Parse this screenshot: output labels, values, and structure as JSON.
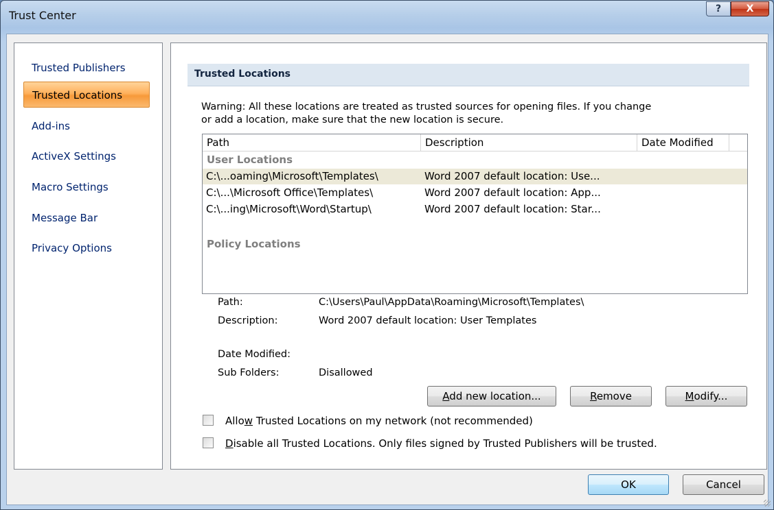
{
  "window": {
    "title": "Trust Center",
    "help_label": "?",
    "close_label": "X"
  },
  "sidebar": {
    "items": [
      {
        "label": "Trusted Publishers"
      },
      {
        "label": "Trusted Locations"
      },
      {
        "label": "Add-ins"
      },
      {
        "label": "ActiveX Settings"
      },
      {
        "label": "Macro Settings"
      },
      {
        "label": "Message Bar"
      },
      {
        "label": "Privacy Options"
      }
    ]
  },
  "main": {
    "section_title": "Trusted Locations",
    "warning_line1": "Warning: All these locations are treated as trusted sources for opening files.  If you change",
    "warning_line2": "or add a location, make sure that the new location is secure.",
    "list": {
      "columns": [
        "Path",
        "Description",
        "Date Modified"
      ],
      "user_group": "User Locations",
      "rows": [
        {
          "path": "C:\\...oaming\\Microsoft\\Templates\\",
          "description": "Word 2007 default location: Use...",
          "date": ""
        },
        {
          "path": "C:\\...\\Microsoft Office\\Templates\\",
          "description": "Word 2007 default location: App...",
          "date": ""
        },
        {
          "path": "C:\\...ing\\Microsoft\\Word\\Startup\\",
          "description": "Word 2007 default location: Star...",
          "date": ""
        }
      ],
      "policy_group": "Policy Locations"
    },
    "details": {
      "path_label": "Path:",
      "path_value": "C:\\Users\\Paul\\AppData\\Roaming\\Microsoft\\Templates\\",
      "description_label": "Description:",
      "description_value": "Word 2007 default location: User Templates",
      "date_label": "Date Modified:",
      "date_value": "",
      "subfolders_label": "Sub Folders:",
      "subfolders_value": "Disallowed"
    },
    "buttons": {
      "add_pre": "",
      "add_u": "A",
      "add_post": "dd new location...",
      "remove_pre": "",
      "remove_u": "R",
      "remove_post": "emove",
      "modify_pre": "",
      "modify_u": "M",
      "modify_post": "odify..."
    },
    "checkboxes": {
      "network_pre": "Allo",
      "network_u": "w",
      "network_post": " Trusted Locations on my network (not recommended)",
      "network_checked": false,
      "disable_pre": "",
      "disable_u": "D",
      "disable_post": "isable all Trusted Locations. Only files signed by Trusted Publishers will be trusted.",
      "disable_checked": false
    }
  },
  "footer": {
    "ok_label": "OK",
    "cancel_label": "Cancel"
  },
  "colors": {
    "selected_nav": "#ffb15c",
    "header_band": "#dde7f1",
    "close": "#c9452a"
  },
  "icons": [
    "help-icon",
    "close-icon",
    "resize-grip-icon"
  ]
}
